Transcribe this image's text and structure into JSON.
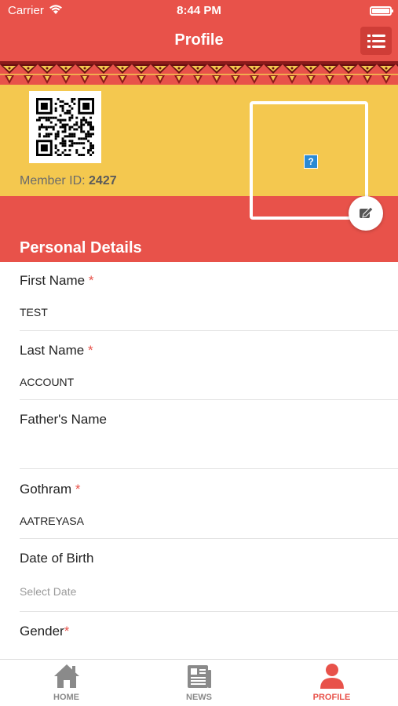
{
  "status_bar": {
    "carrier": "Carrier",
    "time": "8:44 PM"
  },
  "nav": {
    "title": "Profile",
    "menu_icon": "list-menu-icon"
  },
  "header": {
    "member_id_label": "Member ID:",
    "member_id_value": "2427"
  },
  "section": {
    "title": "Personal Details"
  },
  "form": {
    "fields": [
      {
        "label": "First Name",
        "required": "*",
        "value": "TEST"
      },
      {
        "label": "Last Name",
        "required": "*",
        "value": "ACCOUNT"
      },
      {
        "label": "Father's Name",
        "required": "",
        "value": ""
      },
      {
        "label": "Gothram",
        "required": "*",
        "value": "AATREYASA"
      },
      {
        "label": "Date of Birth",
        "required": "",
        "value": "",
        "placeholder": "Select Date"
      },
      {
        "label": "Gender",
        "required": "*",
        "value": ""
      }
    ]
  },
  "tabs": [
    {
      "label": "HOME",
      "icon": "home-icon",
      "active": false
    },
    {
      "label": "NEWS",
      "icon": "news-icon",
      "active": false
    },
    {
      "label": "PROFILE",
      "icon": "profile-icon",
      "active": true
    }
  ],
  "colors": {
    "primary": "#e8524a",
    "header_yellow": "#f4c84f",
    "inactive_tab": "#8a8a8a"
  }
}
